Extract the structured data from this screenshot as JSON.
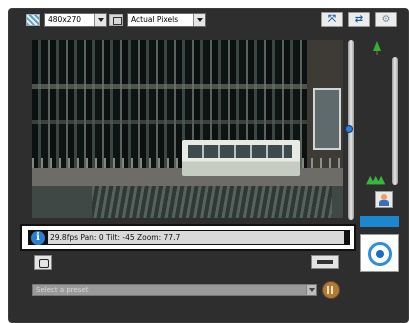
{
  "toolbar": {
    "resolution": "480x270",
    "zoom_mode": "Actual Pixels",
    "icons": [
      "resolution-icon",
      "zoom-mode-icon",
      "fit-view-icon",
      "swap-icon",
      "settings-icon"
    ]
  },
  "status": {
    "text": "29.8fps Pan: 0 Tilt: -45 Zoom: 77.7",
    "info_symbol": "i"
  },
  "preset": {
    "placeholder": "Select a preset"
  },
  "colors": {
    "panel": "#2e2e2e",
    "accent": "#1c87cf",
    "status_bg": "#d9d9d9"
  }
}
